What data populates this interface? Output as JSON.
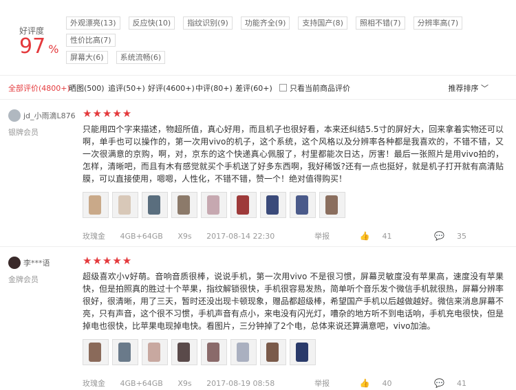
{
  "summary": {
    "label": "好评度",
    "rate": "97",
    "unit": "%"
  },
  "tags": [
    "外观漂亮(13)",
    "反应快(10)",
    "指纹识别(9)",
    "功能齐全(9)",
    "支持国产(8)",
    "照相不错(7)",
    "分辨率高(7)",
    "性价比高(7)",
    "屏幕大(6)",
    "系统流畅(6)"
  ],
  "filters": {
    "items": [
      "全部评价(4800+)",
      "晒图(500)",
      "追评(50+)",
      "好评(4600+)",
      "中评(80+)",
      "差评(60+)"
    ],
    "current_only": "只看当前商品评价",
    "sort": "推荐排序"
  },
  "reviews": [
    {
      "user": "jd_小雨滴L876",
      "level": "银牌会员",
      "stars": "★★★★★",
      "text": "只能用四个字来描述，物超所值，真心好用，而且机子也很好看，本来还纠结5.5寸的屏好大，回来拿着实物还可以啊，单手也可以操作的，第一次用vivo的机子，这个系统，这个风格以及分辨率各种都是我喜欢的，不错不错，又一次很满意的京购，啊，对，京东的这个快递真心佩服了，村里都能次日达，厉害！最后一张照片是用vivo拍的，怎样，清晰吧，而且有木有感觉就买个手机送了好多东西啊，我好稀饭?还有一点也挺好，就是机子打开就有高清贴膜，可以直接使用，嗯嗯，人性化，不错不错，赞一个！绝对值得购买！",
      "color": "玫瑰金",
      "spec": "4GB+64GB",
      "model": "X9s",
      "date": "2017-08-14 22:30",
      "report": "举报",
      "likes": "41",
      "comments": "35",
      "thumb_colors": [
        "#c9a989",
        "#d8c8b8",
        "#5a6e7e",
        "#8c7a6a",
        "#c6a8b0",
        "#9e3a3a",
        "#3a4a7a",
        "#4a5a8a",
        "#8a6e5e"
      ]
    },
    {
      "user": "李***语",
      "level": "金牌会员",
      "stars": "★★★★★",
      "text": "超级喜欢小v好萌。音响音质很棒，说说手机，第一次用vivo 不是很习惯，屏幕灵敏度没有苹果高，速度没有苹果快，但是拍照真的胜过十个苹果，指纹解锁很快，手机很容易发热，简单听个音乐发个微信手机就很热，屏幕分辨率很好，很清晰，用了三天，暂时还没出现卡顿现象，赠品都超级棒，希望国产手机以后越做越好。微信来消息屏幕不亮，只有声音，这个很不习惯，手机声音有点小，来电没有闪光灯，嘈杂的地方听不到电话响，手机充电很快，但是掉电也很快，比苹果电现掉电快。看图片，三分钟掉了2个电，总体来说还算满意吧，vivo加油。",
      "color": "玫瑰金",
      "spec": "4GB+64GB",
      "model": "X9s",
      "date": "2017-08-19 08:58",
      "report": "举报",
      "likes": "40",
      "comments": "41",
      "thumb_colors": [
        "#8a6a5a",
        "#6a7a8a",
        "#c8a8a0",
        "#5a4a4a",
        "#8a6a6a",
        "#aab0c0",
        "#7a5a4a",
        "#2a3a6a"
      ]
    }
  ]
}
